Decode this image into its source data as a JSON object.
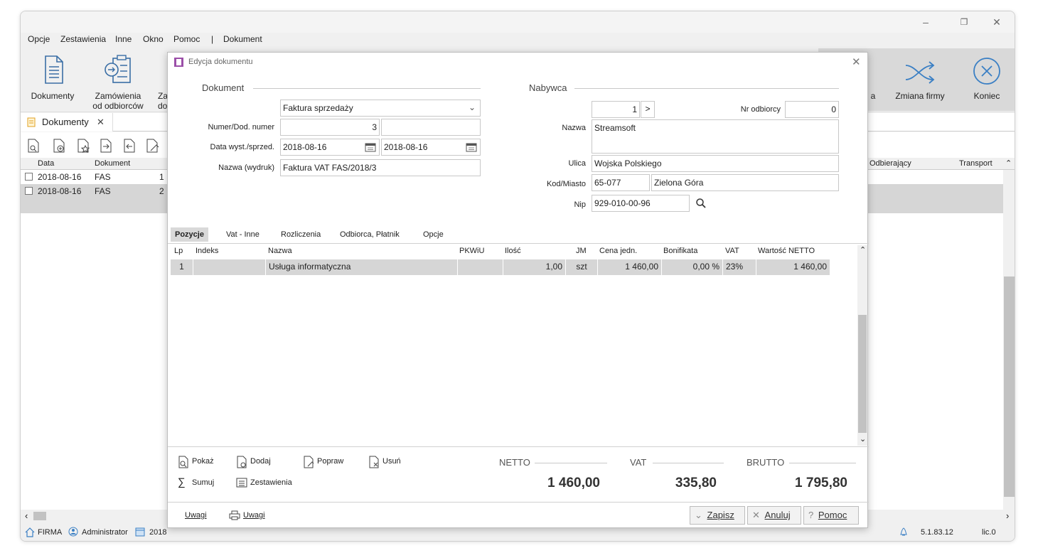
{
  "window": {
    "minimize": "–",
    "restore": "❐",
    "close": "✕"
  },
  "menu": {
    "items": [
      "Opcje",
      "Zestawienia",
      "Inne",
      "Okno",
      "Pomoc",
      "|",
      "Dokument"
    ]
  },
  "ribbon": {
    "dokumenty": "Dokumenty",
    "zamowienia_1": "Zamówienia",
    "zamowienia_2": "od odbiorców",
    "cut_1": "Za",
    "cut_2": "do",
    "cut_right": "a",
    "zmiana_firmy": "Zmiana firmy",
    "koniec": "Koniec"
  },
  "tab": {
    "label": "Dokumenty",
    "close": "✕"
  },
  "list": {
    "headers": [
      "Data",
      "Dokument",
      "Odbierający",
      "Transport"
    ],
    "rows": [
      {
        "date": "2018-08-16",
        "doc": "FAS",
        "num": "1"
      },
      {
        "date": "2018-08-16",
        "doc": "FAS",
        "num": "2"
      }
    ]
  },
  "status": {
    "firma": "FIRMA",
    "user": "Administrator",
    "year": "2018",
    "version": "5.1.83.12",
    "lic": "lic.0"
  },
  "dialog": {
    "title": "Edycja dokumentu",
    "dokument_section": "Dokument",
    "nabywca_section": "Nabywca",
    "doc_type": "Faktura sprzedaży",
    "numer_label": "Numer/Dod. numer",
    "numer_value": "3",
    "numer_extra": "",
    "data_label": "Data wyst./sprzed.",
    "data_wyst": "2018-08-16",
    "data_sprzed": "2018-08-16",
    "nazwa_wydruk_label": "Nazwa (wydruk)",
    "nazwa_wydruk": "Faktura VAT FAS/2018/3",
    "buyer_number": "1",
    "nr_odbiorcy_label": "Nr odbiorcy",
    "nr_odbiorcy": "0",
    "nazwa_label": "Nazwa",
    "nazwa": "Streamsoft",
    "ulica_label": "Ulica",
    "ulica": "Wojska Polskiego",
    "kod_label": "Kod/Miasto",
    "kod": "65-077",
    "miasto": "Zielona Góra",
    "nip_label": "Nip",
    "nip": "929-010-00-96",
    "tabs": [
      "Pozycje",
      "Vat - Inne",
      "Rozliczenia",
      "Odbiorca, Płatnik",
      "Opcje"
    ],
    "grid_headers": [
      "Lp",
      "Indeks",
      "Nazwa",
      "PKWiU",
      "Ilość",
      "JM",
      "Cena jedn.",
      "Bonifikata",
      "VAT",
      "Wartość NETTO"
    ],
    "grid_rows": [
      {
        "lp": "1",
        "indeks": "",
        "nazwa": "Usługa informatyczna",
        "pkwiu": "",
        "ilosc": "1,00",
        "jm": "szt",
        "cena": "1 460,00",
        "bonifikata": "0,00 %",
        "vat": "23%",
        "netto": "1 460,00"
      }
    ],
    "actions": {
      "pokaz": "Pokaż",
      "dodaj": "Dodaj",
      "popraw": "Popraw",
      "usun": "Usuń",
      "sumuj": "Sumuj",
      "zestawienia": "Zestawienia"
    },
    "totals": {
      "netto_label": "NETTO",
      "vat_label": "VAT",
      "brutto_label": "BRUTTO",
      "netto": "1 460,00",
      "vat": "335,80",
      "brutto": "1 795,80"
    },
    "footer": {
      "uwagi": "Uwagi",
      "uwagi_print": "Uwagi",
      "zapisz": "Zapisz",
      "anuluj": "Anuluj",
      "pomoc": "Pomoc"
    }
  }
}
